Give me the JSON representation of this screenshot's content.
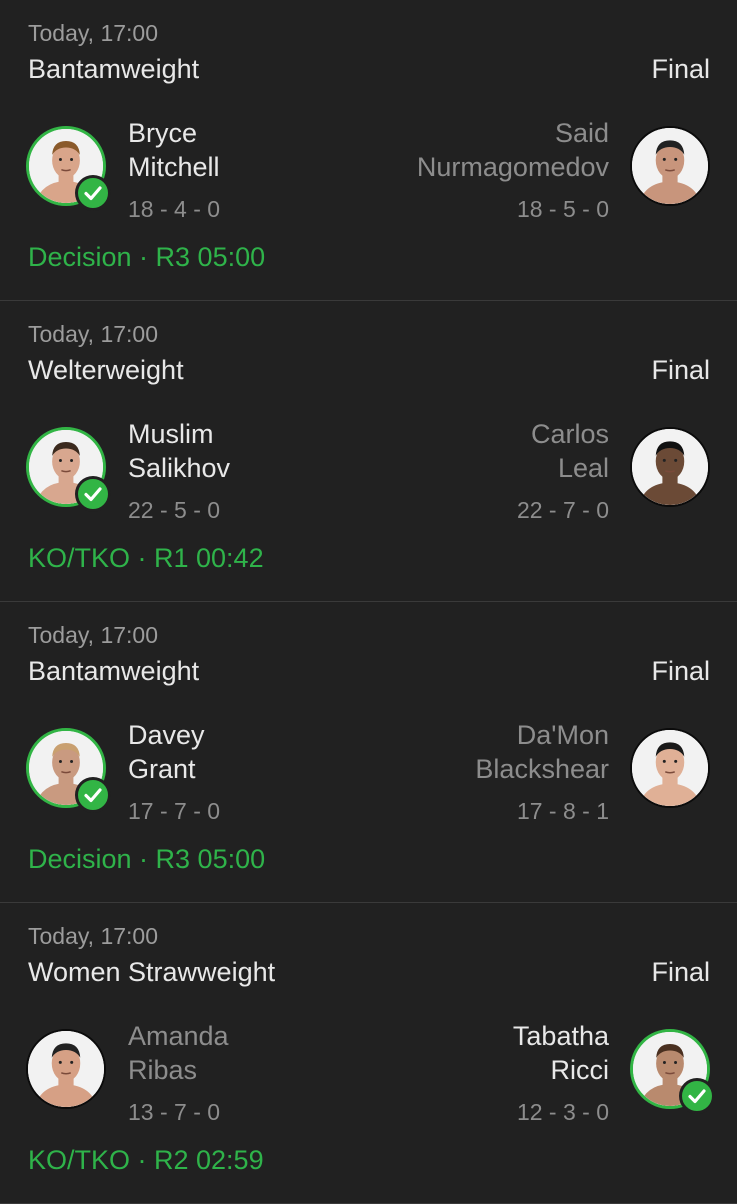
{
  "colors": {
    "background": "#212121",
    "accent_green": "#32b545",
    "primary_text": "#e8e8e8",
    "secondary_text": "#8d8d8d"
  },
  "fights": [
    {
      "time": "Today, 17:00",
      "division": "Bantamweight",
      "status": "Final",
      "left": {
        "first": "Bryce",
        "last": "Mitchell",
        "record": "18 - 4 - 0",
        "winner": true
      },
      "right": {
        "first": "Said",
        "last": "Nurmagomedov",
        "record": "18 - 5 - 0",
        "winner": false
      },
      "result": "Decision · R3 05:00"
    },
    {
      "time": "Today, 17:00",
      "division": "Welterweight",
      "status": "Final",
      "left": {
        "first": "Muslim",
        "last": "Salikhov",
        "record": "22 - 5 - 0",
        "winner": true
      },
      "right": {
        "first": "Carlos",
        "last": "Leal",
        "record": "22 - 7 - 0",
        "winner": false
      },
      "result": "KO/TKO · R1 00:42"
    },
    {
      "time": "Today, 17:00",
      "division": "Bantamweight",
      "status": "Final",
      "left": {
        "first": "Davey",
        "last": "Grant",
        "record": "17 - 7 - 0",
        "winner": true
      },
      "right": {
        "first": "Da'Mon",
        "last": "Blackshear",
        "record": "17 - 8 - 1",
        "winner": false
      },
      "result": "Decision · R3 05:00"
    },
    {
      "time": "Today, 17:00",
      "division": "Women Strawweight",
      "status": "Final",
      "left": {
        "first": "Amanda",
        "last": "Ribas",
        "record": "13 - 7 - 0",
        "winner": false
      },
      "right": {
        "first": "Tabatha",
        "last": "Ricci",
        "record": "12 - 3 - 0",
        "winner": true
      },
      "result": "KO/TKO · R2 02:59"
    }
  ]
}
